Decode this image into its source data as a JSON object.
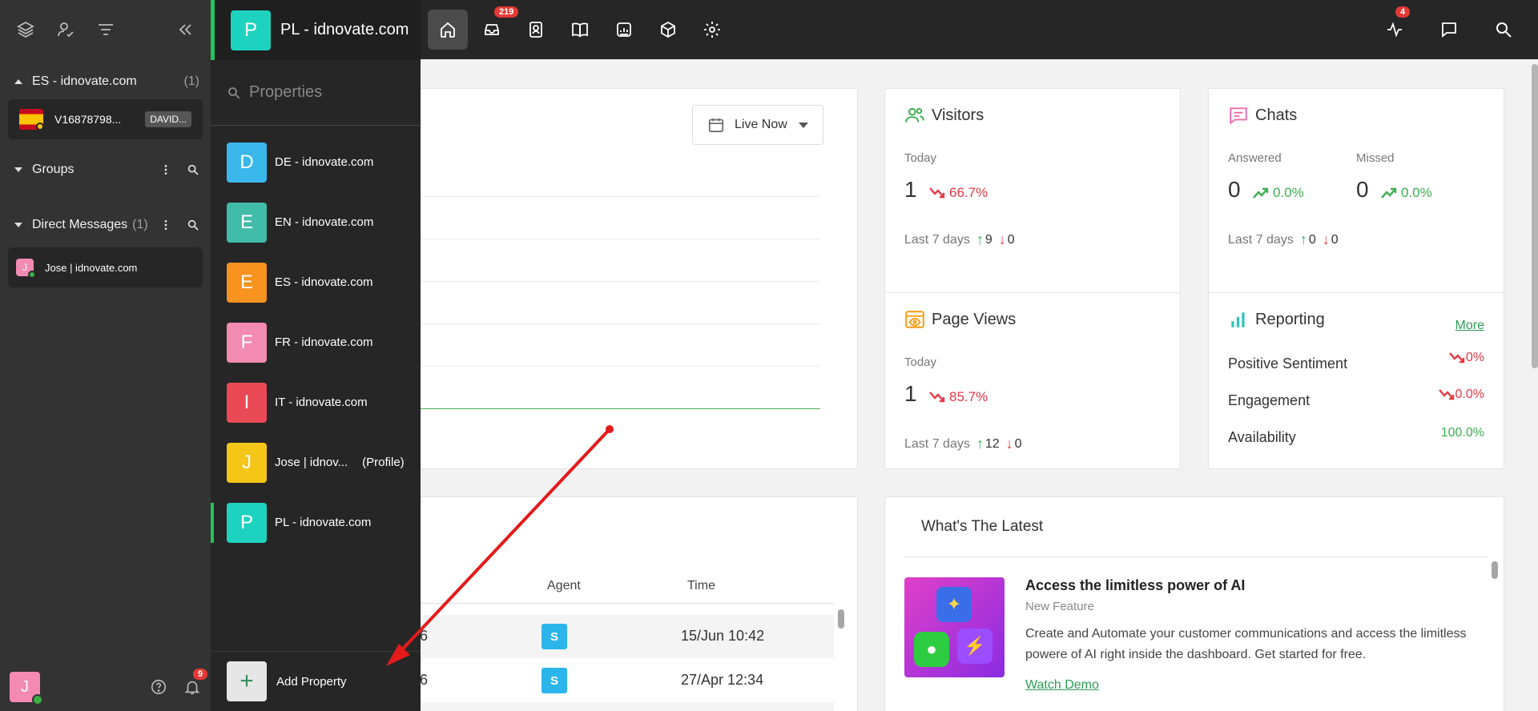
{
  "sidebar": {
    "sections": [
      {
        "title": "ES - idnovate.com",
        "count": "(1)"
      },
      {
        "title": "Groups"
      },
      {
        "title": "Direct Messages",
        "count": "(1)"
      }
    ],
    "visitor": {
      "name": "V16878798...",
      "agent_badge": "DAVID..."
    },
    "dm": {
      "name": "Jose | idnovate.com",
      "initial": "J"
    },
    "user_initial": "J",
    "notifications": "9"
  },
  "properties": {
    "current": {
      "initial": "P",
      "name": "PL - idnovate.com",
      "color": "#1dd3c0"
    },
    "search_placeholder": "Properties",
    "items": [
      {
        "initial": "D",
        "name": "DE - idnovate.com",
        "color": "#3ab8ec"
      },
      {
        "initial": "E",
        "name": "EN - idnovate.com",
        "color": "#40bca9"
      },
      {
        "initial": "E",
        "name": "ES - idnovate.com",
        "color": "#f7931e"
      },
      {
        "initial": "F",
        "name": "FR - idnovate.com",
        "color": "#f28ab2"
      },
      {
        "initial": "I",
        "name": "IT - idnovate.com",
        "color": "#ea4a55"
      },
      {
        "initial": "J",
        "name": "Jose | idnov...",
        "tag": "(Profile)",
        "color": "#f5c518"
      },
      {
        "initial": "P",
        "name": "PL - idnovate.com",
        "color": "#1dd3c0"
      }
    ],
    "add_label": "Add Property",
    "add_icon": "+"
  },
  "topbar": {
    "inbox_badge": "219",
    "activity_badge": "4"
  },
  "chart_card": {
    "live_label": "Live Now"
  },
  "visitors": {
    "title": "Visitors",
    "today_label": "Today",
    "today_value": "1",
    "trend": "66.7%",
    "last7_label": "Last 7 days",
    "up": "9",
    "down": "0"
  },
  "chats": {
    "title": "Chats",
    "answered_label": "Answered",
    "answered_value": "0",
    "answered_trend": "0.0%",
    "missed_label": "Missed",
    "missed_value": "0",
    "missed_trend": "0.0%",
    "last7_label": "Last 7 days",
    "up": "0",
    "down": "0"
  },
  "pageviews": {
    "title": "Page Views",
    "today_label": "Today",
    "today_value": "1",
    "trend": "85.7%",
    "last7_label": "Last 7 days",
    "up": "12",
    "down": "0"
  },
  "reporting": {
    "title": "Reporting",
    "more": "More",
    "rows": [
      {
        "label": "Positive Sentiment",
        "value": "0%"
      },
      {
        "label": "Engagement",
        "value": "0.0%"
      },
      {
        "label": "Availability",
        "value": "100.0%"
      }
    ]
  },
  "table": {
    "headers": {
      "agent": "Agent",
      "time": "Time"
    },
    "rows": [
      {
        "col1": "6",
        "agent": "S",
        "time": "15/Jun 10:42"
      },
      {
        "col1": "6",
        "agent": "S",
        "time": "27/Apr 12:34"
      }
    ]
  },
  "latest": {
    "title": "What's The Latest",
    "news_title": "Access the limitless power of AI",
    "news_sub": "New Feature",
    "news_desc": "Create and Automate your customer communications and access the limitless powere of AI right inside the dashboard. Get started for free.",
    "news_link": "Watch Demo"
  },
  "colors": {
    "accent_green": "#22c55e",
    "trend_red": "#e53945",
    "trend_green": "#3cae4e",
    "badge_red": "#e53935"
  }
}
